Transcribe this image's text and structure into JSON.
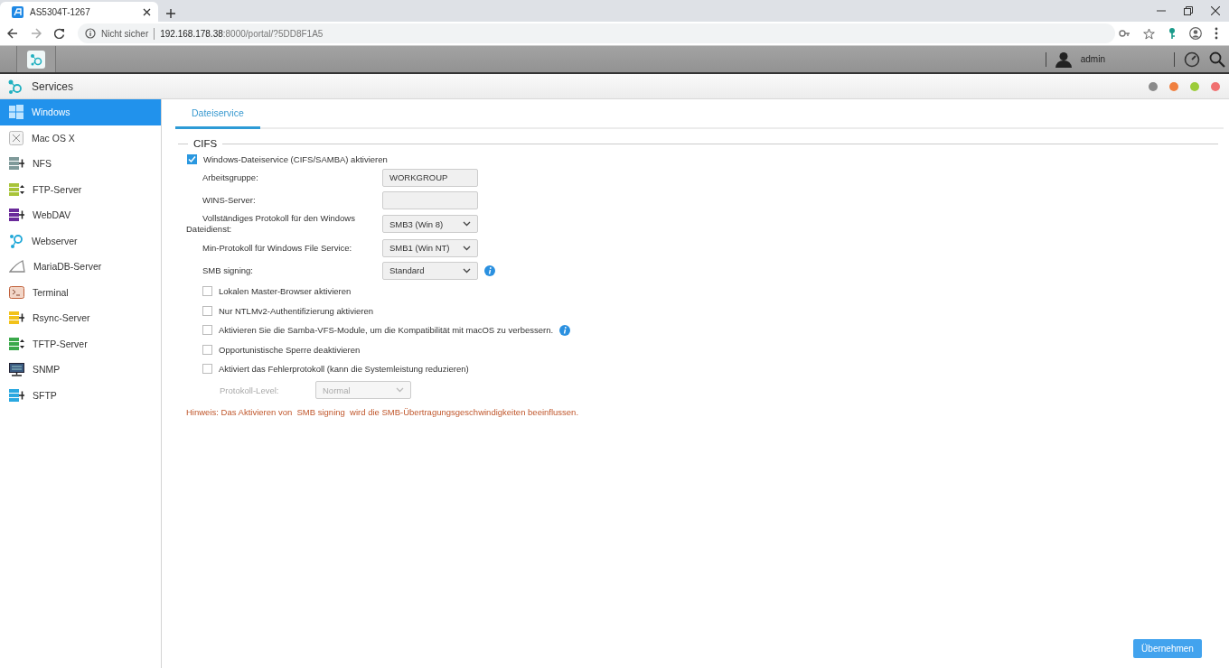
{
  "browser": {
    "tab_title": "AS5304T-1267",
    "security_label": "Nicht sicher",
    "url_host": "192.168.178.38",
    "url_rest": ":8000/portal/?5DD8F1A5"
  },
  "toolbar": {
    "user": "admin"
  },
  "app": {
    "title": "Services"
  },
  "sidebar": {
    "items": [
      {
        "label": "Windows",
        "kind": "windows",
        "selected": true
      },
      {
        "label": "Mac OS X",
        "kind": "macos",
        "selected": false
      },
      {
        "label": "NFS",
        "kind": "server",
        "color": "#7f9a9a",
        "selected": false
      },
      {
        "label": "FTP-Server",
        "kind": "transfer",
        "color": "#a8c43a",
        "selected": false
      },
      {
        "label": "WebDAV",
        "kind": "server",
        "color": "#6a2a9a",
        "selected": false
      },
      {
        "label": "Webserver",
        "kind": "nodes",
        "selected": false
      },
      {
        "label": "MariaDB-Server",
        "kind": "fin",
        "selected": false
      },
      {
        "label": "Terminal",
        "kind": "terminal",
        "selected": false
      },
      {
        "label": "Rsync-Server",
        "kind": "server",
        "color": "#f2c21a",
        "selected": false
      },
      {
        "label": "TFTP-Server",
        "kind": "transfer",
        "color": "#3aa84a",
        "selected": false
      },
      {
        "label": "SNMP",
        "kind": "monitor",
        "selected": false
      },
      {
        "label": "SFTP",
        "kind": "server",
        "color": "#2aa8e0",
        "selected": false
      }
    ]
  },
  "tabs": [
    {
      "label": "Dateiservice",
      "selected": true
    }
  ],
  "section": {
    "title": "CIFS"
  },
  "enable": {
    "label": "Windows-Dateiservice (CIFS/SAMBA) aktivieren",
    "checked": true
  },
  "fields": [
    {
      "kind": "text",
      "label": "Arbeitsgruppe:",
      "value": "WORKGROUP"
    },
    {
      "kind": "text",
      "label": "WINS-Server:"
    },
    {
      "kind": "select",
      "label": "Vollständiges Protokoll für den Windows\nDateidienst:",
      "value": "SMB3 (Win 8)"
    },
    {
      "kind": "select",
      "label": "Min-Protokoll für Windows File Service:",
      "value": "SMB1 (Win NT)"
    },
    {
      "kind": "select",
      "label": "SMB signing:",
      "value": "Standard",
      "info": true
    }
  ],
  "options": [
    {
      "label": "Lokalen Master-Browser aktivieren",
      "checked": false
    },
    {
      "label": "Nur NTLMv2-Authentifizierung aktivieren",
      "checked": false
    },
    {
      "label": "Aktivieren Sie die Samba-VFS-Module, um die Kompatibilität mit macOS zu verbessern.",
      "checked": false,
      "info": true
    },
    {
      "label": "Opportunistische Sperre deaktivieren",
      "checked": false
    },
    {
      "label": "Aktiviert das Fehlerprotokoll (kann die Systemleistung reduzieren)",
      "checked": false
    }
  ],
  "log_level": {
    "label": "Protokoll-Level:",
    "value": "Normal",
    "disabled": true
  },
  "note": "Hinweis: Das Aktivieren von  SMB signing  wird die SMB-Übertragungsgeschwindigkeiten beeinflussen.",
  "apply_button": "Übernehmen"
}
